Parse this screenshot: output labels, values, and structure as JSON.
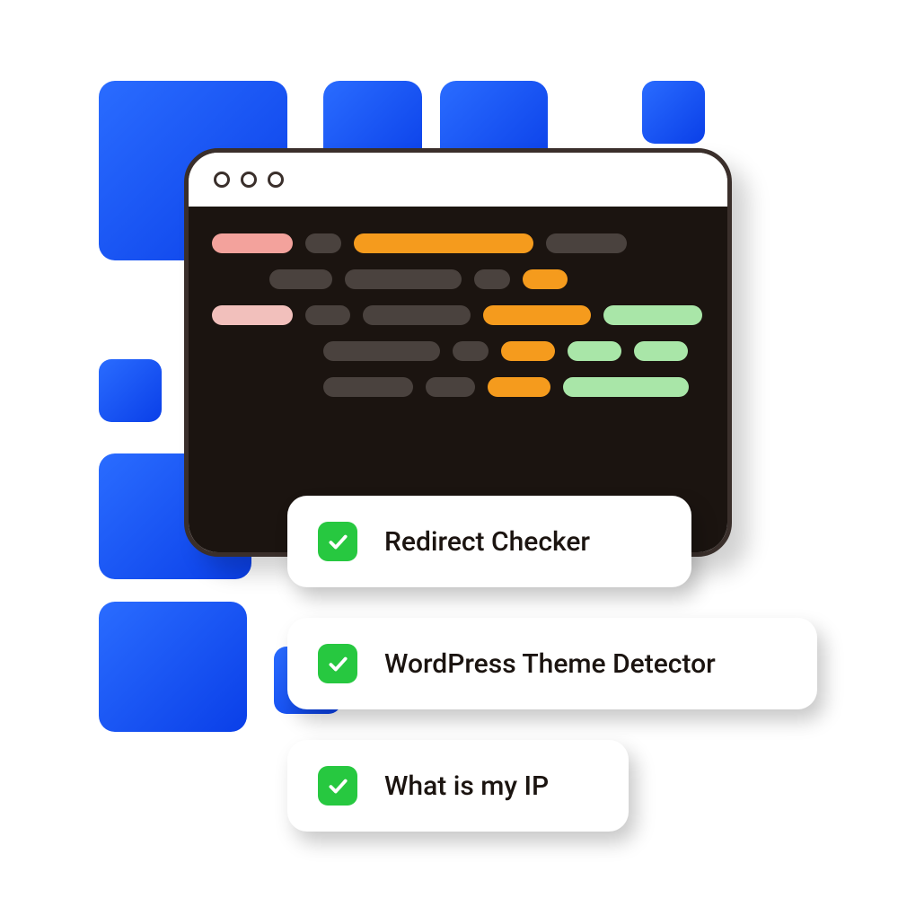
{
  "tools": [
    {
      "label": "Redirect Checker"
    },
    {
      "label": "WordPress Theme Detector"
    },
    {
      "label": "What is my IP"
    }
  ]
}
